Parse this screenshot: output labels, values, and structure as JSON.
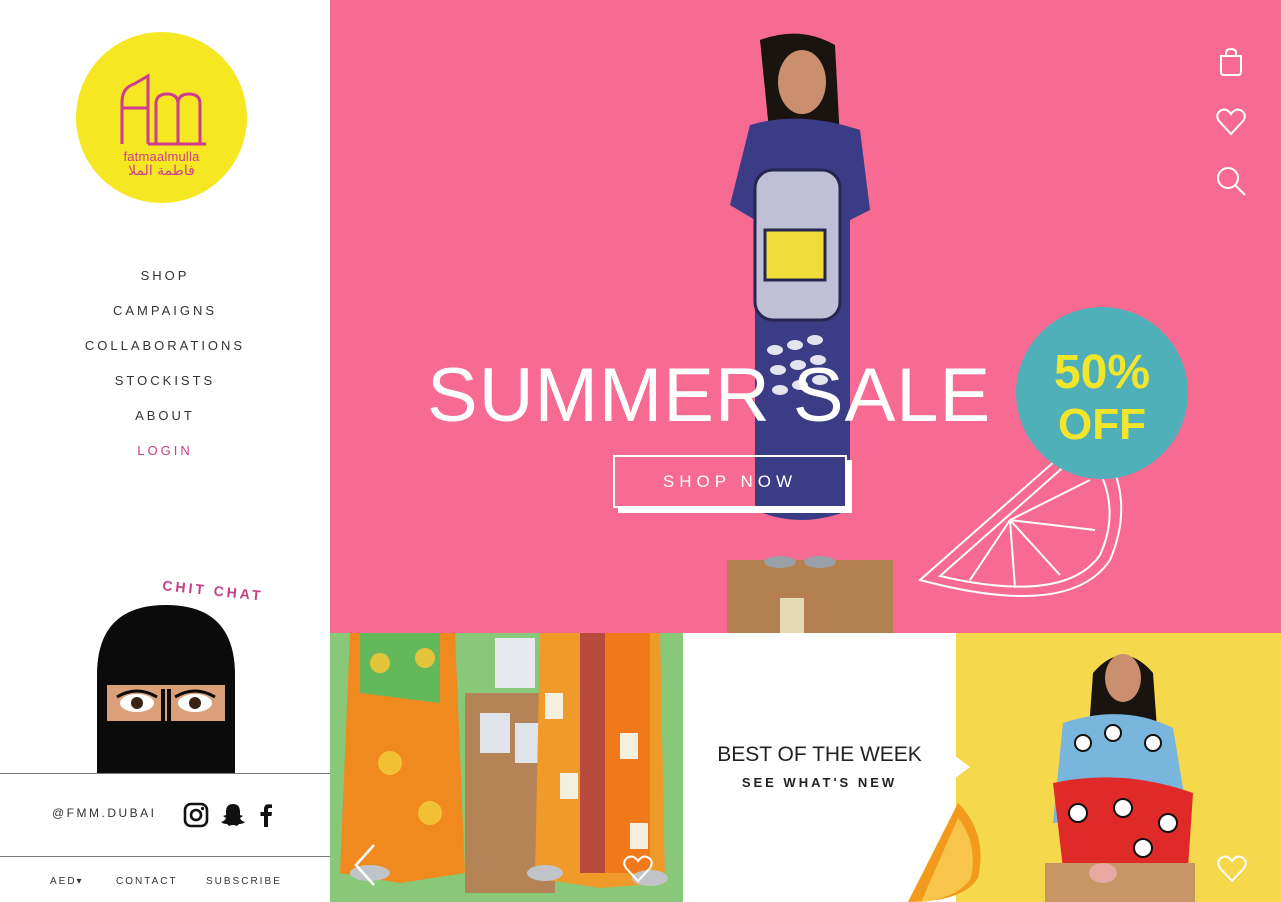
{
  "brand": {
    "logo_monogram": "fm",
    "logo_latin": "fatmaalmulla",
    "logo_arabic": "فاطمة الملا",
    "logo_bg_color": "#f5e822",
    "logo_fg_color": "#d03d8f"
  },
  "nav": {
    "items": [
      {
        "label": "SHOP"
      },
      {
        "label": "CAMPAIGNS"
      },
      {
        "label": "COLLABORATIONS"
      },
      {
        "label": "STOCKISTS"
      },
      {
        "label": "ABOUT"
      },
      {
        "label": "LOGIN"
      }
    ]
  },
  "chit_chat": {
    "label": "CHIT CHAT"
  },
  "social": {
    "handle": "@FMM.DUBAI",
    "icons": [
      "instagram-icon",
      "snapchat-icon",
      "facebook-icon"
    ]
  },
  "footer": {
    "currency": "AED▾",
    "contact": "CONTACT",
    "subscribe": "SUBSCRIBE"
  },
  "hero": {
    "title": "SUMMER SALE",
    "cta": "SHOP NOW",
    "badge_line1": "50%",
    "badge_line2": "OFF",
    "bg_color": "#f76b92",
    "badge_color": "#4fb0ba",
    "badge_text_color": "#f2e62c",
    "icons": [
      "shopping-bag-icon",
      "heart-icon",
      "search-icon"
    ]
  },
  "feature_tile": {
    "title": "BEST OF THE WEEK",
    "subtitle": "SEE WHAT'S NEW",
    "bg_color": "#f5d84b"
  }
}
